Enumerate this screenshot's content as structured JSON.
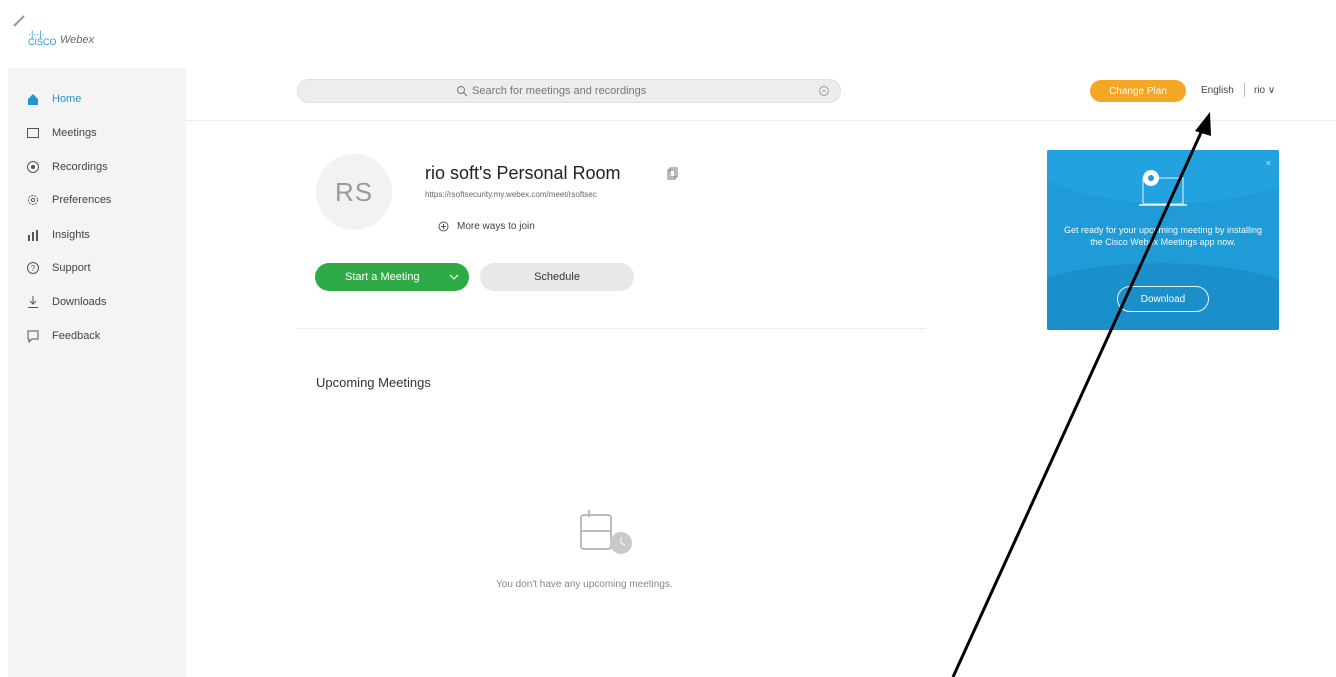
{
  "brand": {
    "logo_bars": "·|··|·",
    "logo_text": "CISCO",
    "product": "Webex"
  },
  "sidebar": {
    "items": [
      {
        "label": "Home",
        "icon": "home-icon",
        "active": true
      },
      {
        "label": "Meetings",
        "icon": "calendar-icon"
      },
      {
        "label": "Recordings",
        "icon": "recording-icon"
      },
      {
        "label": "Preferences",
        "icon": "gear-icon"
      },
      {
        "label": "Insights",
        "icon": "chart-icon"
      },
      {
        "label": "Support",
        "icon": "help-icon"
      },
      {
        "label": "Downloads",
        "icon": "download-icon"
      },
      {
        "label": "Feedback",
        "icon": "feedback-icon"
      }
    ]
  },
  "header": {
    "search_placeholder": "Search for meetings and recordings",
    "change_plan_label": "Change Plan",
    "language": "English",
    "user_menu": "rio ∨"
  },
  "room": {
    "avatar_initials": "RS",
    "title": "rio soft's Personal Room",
    "url": "https://rsoftsecurity.my.webex.com/meet/rsoftsec",
    "more_ways": "More ways to join",
    "start_label": "Start a Meeting",
    "schedule_label": "Schedule"
  },
  "upcoming": {
    "title": "Upcoming Meetings",
    "empty_text": "You don't have any upcoming meetings."
  },
  "promo": {
    "message": "Get ready for your upcoming meeting by installing the Cisco Webex Meetings app now.",
    "download_label": "Download",
    "close": "×"
  },
  "colors": {
    "accent": "#1f97d6",
    "start_green": "#2eaa46",
    "change_plan_orange": "#f5a623",
    "promo_blue": "#1f9bd7"
  }
}
